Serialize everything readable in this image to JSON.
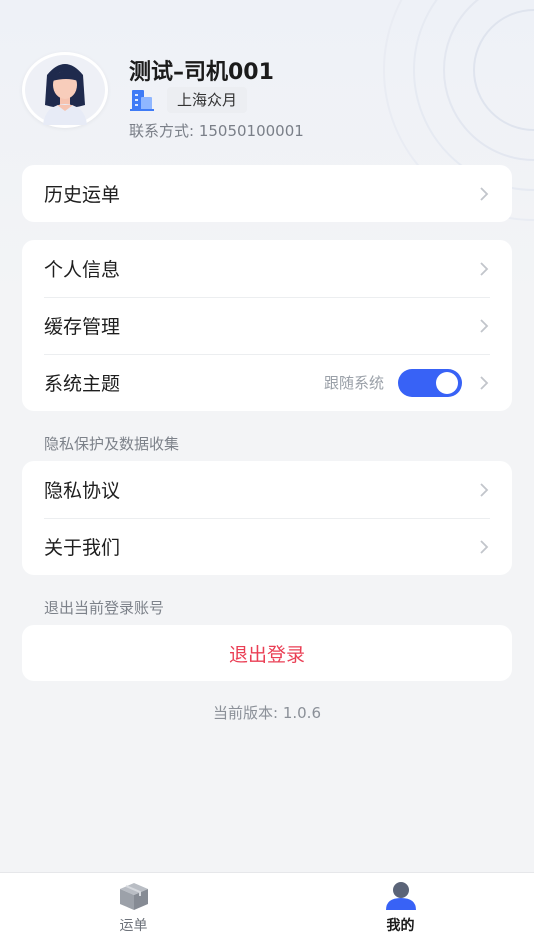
{
  "profile": {
    "name": "测试–司机001",
    "company": "上海众月",
    "contact": "联系方式: 15050100001"
  },
  "menu": {
    "history": "历史运单",
    "personal_info": "个人信息",
    "cache": "缓存管理",
    "theme": "系统主题",
    "theme_value": "跟随系统",
    "theme_toggle_on": true,
    "privacy_section": "隐私保护及数据收集",
    "privacy_policy": "隐私协议",
    "about": "关于我们",
    "logout_section": "退出当前登录账号",
    "logout": "退出登录"
  },
  "version": "当前版本: 1.0.6",
  "tabbar": {
    "items": [
      {
        "label": "运单",
        "icon": "box-icon",
        "active": false
      },
      {
        "label": "我的",
        "icon": "person-icon",
        "active": true
      }
    ]
  },
  "colors": {
    "accent": "#3862f6",
    "danger": "#ea3f55",
    "background": "#f3f4f6"
  }
}
